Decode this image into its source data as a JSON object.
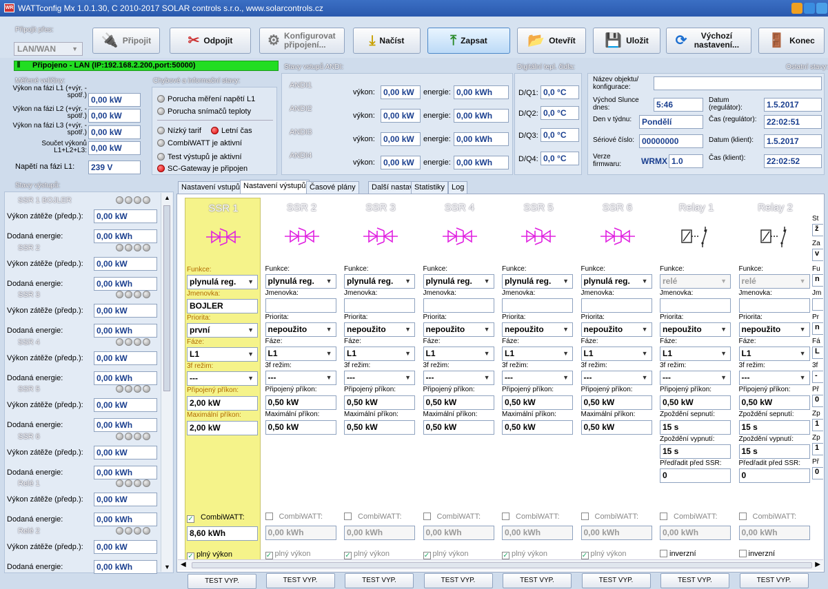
{
  "window": {
    "title": "WATTconfig Mx 1.0.1.30, C 2010-2017 SOLAR controls s.r.o., www.solarcontrols.cz",
    "app_icon": "WR"
  },
  "connect": {
    "group_title": "Připojit přes:",
    "via": "LAN/WAN"
  },
  "toolbar": {
    "connect": "Připojit",
    "disconnect": "Odpojit",
    "config_connection": "Konfigurovat připojení...",
    "load": "Načíst",
    "write": "Zapsat",
    "open": "Otevřít",
    "save": "Uložit",
    "defaults": "Výchozí nastavení...",
    "exit": "Konec"
  },
  "status": {
    "text": "Připojeno - LAN (IP:192.168.2.200,port:50000)",
    "color": "#22dd22"
  },
  "measured": {
    "title": "Měřené veličiny:",
    "rows": [
      {
        "label": "Výkon na fázi L1 (+výr. -spotř.)",
        "value": "0,00 kW"
      },
      {
        "label": "Výkon na fázi L2 (+výr. -spotř.)",
        "value": "0,00 kW"
      },
      {
        "label": "Výkon na fázi L3 (+výr. -spotř.)",
        "value": "0,00 kW"
      },
      {
        "label": "Součet výkonů L1+L2+L3:",
        "value": "0,00 kW"
      }
    ],
    "voltage_label": "Napětí na fázi L1:",
    "voltage_value": "239 V"
  },
  "errors": {
    "title": "Chybové a informační stavy:",
    "items": [
      "Porucha měření napětí L1",
      "Porucha snímačů teploty"
    ],
    "tariff": "Nízký tarif",
    "summer": "Letní čas",
    "combi": "CombiWATT je aktivní",
    "test": "Test výstupů je aktivní",
    "gateway": "SC-Gateway je připojen"
  },
  "andi": {
    "title": "Stavy vstupů ANDI:",
    "power_label": "výkon:",
    "energy_label": "energie:",
    "rows": [
      {
        "name": "ANDI1",
        "power": "0,00 kW",
        "energy": "0,00 kWh"
      },
      {
        "name": "ANDI2",
        "power": "0,00 kW",
        "energy": "0,00 kWh"
      },
      {
        "name": "ANDI3",
        "power": "0,00 kW",
        "energy": "0,00 kWh"
      },
      {
        "name": "ANDI4",
        "power": "0,00 kW",
        "energy": "0,00 kWh"
      }
    ]
  },
  "digital": {
    "title": "Digitální tepl. čidla:",
    "rows": [
      {
        "name": "D/Q1:",
        "value": "0,0 °C"
      },
      {
        "name": "D/Q2:",
        "value": "0,0 °C"
      },
      {
        "name": "D/Q3:",
        "value": "0,0 °C"
      },
      {
        "name": "D/Q4:",
        "value": "0,0 °C"
      }
    ]
  },
  "other": {
    "title": "Ostatní stavy:",
    "object_label": "Název objektu/ konfigurace:",
    "object_value": "",
    "sunrise_label": "Východ Slunce dnes:",
    "sunrise_value": "5:46",
    "date_reg_label": "Datum (regulátor):",
    "date_reg_value": "1.5.2017",
    "weekday_label": "Den v týdnu:",
    "weekday_value": "Pondělí",
    "time_reg_label": "Čas (regulátor):",
    "time_reg_value": "22:02:51",
    "serial_label": "Sériové číslo:",
    "serial_value": "00000000",
    "date_client_label": "Datum (klient):",
    "date_client_value": "1.5.2017",
    "fw_label": "Verze firmwaru:",
    "fw_name": "WRMX",
    "fw_version": "1.0",
    "time_client_label": "Čas (klient):",
    "time_client_value": "22:02:52"
  },
  "outputs": {
    "title": "Stavy výstupů:",
    "load_label": "Výkon zátěže (předp.):",
    "energy_label": "Dodaná energie:",
    "items": [
      {
        "name": "SSR 1 BOJLER",
        "load": "0,00 kW",
        "energy": "0,00 kWh"
      },
      {
        "name": "SSR 2",
        "load": "0,00 kW",
        "energy": "0,00 kWh"
      },
      {
        "name": "SSR 3",
        "load": "0,00 kW",
        "energy": "0,00 kWh"
      },
      {
        "name": "SSR 4",
        "load": "0,00 kW",
        "energy": "0,00 kWh"
      },
      {
        "name": "SSR 5",
        "load": "0,00 kW",
        "energy": "0,00 kWh"
      },
      {
        "name": "SSR 6",
        "load": "0,00 kW",
        "energy": "0,00 kWh"
      },
      {
        "name": "Relé 1",
        "load": "0,00 kW",
        "energy": "0,00 kWh"
      },
      {
        "name": "Relé 2",
        "load": "0,00 kW",
        "energy": "0,00 kWh"
      }
    ]
  },
  "tabs": [
    "Nastavení vstupů",
    "Nastavení výstupů",
    "Časové plány",
    "Další nastavení",
    "Statistiky",
    "Log"
  ],
  "active_tab": 1,
  "fields": {
    "function": "Funkce:",
    "name": "Jmenovka:",
    "priority": "Priorita:",
    "phase": "Fáze:",
    "mode3f": "3f režim:",
    "connected": "Připojený příkon:",
    "max": "Maximální příkon:",
    "on_delay": "Zpoždění sepnutí:",
    "off_delay": "Zpoždění vypnutí:",
    "preset": "Předřadit před SSR:",
    "combi": "CombiWATT:",
    "full_power": "plný výkon",
    "inverse": "inverzní",
    "test": "TEST VYP."
  },
  "columns": [
    {
      "title": "SSR 1",
      "type": "ssr",
      "function": "plynulá reg.",
      "name": "BOJLER",
      "priority": "první",
      "phase": "L1",
      "mode3f": "---",
      "connected": "2,00 kW",
      "max": "2,00 kW",
      "combi_checked": true,
      "combi_value": "8,60 kWh",
      "full_checked": true
    },
    {
      "title": "SSR 2",
      "type": "ssr",
      "function": "plynulá reg.",
      "name": "",
      "priority": "nepoužito",
      "phase": "L1",
      "mode3f": "---",
      "connected": "0,50 kW",
      "max": "0,50 kW",
      "combi_checked": false,
      "combi_value": "0,00 kWh",
      "full_checked": true
    },
    {
      "title": "SSR 3",
      "type": "ssr",
      "function": "plynulá reg.",
      "name": "",
      "priority": "nepoužito",
      "phase": "L1",
      "mode3f": "---",
      "connected": "0,50 kW",
      "max": "0,50 kW",
      "combi_checked": false,
      "combi_value": "0,00 kWh",
      "full_checked": true
    },
    {
      "title": "SSR 4",
      "type": "ssr",
      "function": "plynulá reg.",
      "name": "",
      "priority": "nepoužito",
      "phase": "L1",
      "mode3f": "---",
      "connected": "0,50 kW",
      "max": "0,50 kW",
      "combi_checked": false,
      "combi_value": "0,00 kWh",
      "full_checked": true
    },
    {
      "title": "SSR 5",
      "type": "ssr",
      "function": "plynulá reg.",
      "name": "",
      "priority": "nepoužito",
      "phase": "L1",
      "mode3f": "---",
      "connected": "0,50 kW",
      "max": "0,50 kW",
      "combi_checked": false,
      "combi_value": "0,00 kWh",
      "full_checked": true
    },
    {
      "title": "SSR 6",
      "type": "ssr",
      "function": "plynulá reg.",
      "name": "",
      "priority": "nepoužito",
      "phase": "L1",
      "mode3f": "---",
      "connected": "0,50 kW",
      "max": "0,50 kW",
      "combi_checked": false,
      "combi_value": "0,00 kWh",
      "full_checked": true
    },
    {
      "title": "Relay 1",
      "type": "relay",
      "function": "relé",
      "name": "",
      "priority": "nepoužito",
      "phase": "L1",
      "mode3f": "---",
      "connected": "0,50 kW",
      "on_delay": "15 s",
      "off_delay": "15 s",
      "preset": "0",
      "combi_checked": false,
      "combi_value": "0,00 kWh",
      "inverse_checked": false
    },
    {
      "title": "Relay 2",
      "type": "relay",
      "function": "relé",
      "name": "",
      "priority": "nepoužito",
      "phase": "L1",
      "mode3f": "---",
      "connected": "0,50 kW",
      "on_delay": "15 s",
      "off_delay": "15 s",
      "preset": "0",
      "combi_checked": false,
      "combi_value": "0,00 kWh",
      "inverse_checked": false
    }
  ],
  "partial_col": {
    "labels": [
      "St",
      "Za",
      "Fu",
      "Jm",
      "Pr",
      "Fá",
      "3f",
      "Př",
      "Zp",
      "Zp",
      "Př"
    ],
    "values": [
      "ž",
      "v",
      "n",
      "",
      "n",
      "L",
      "-",
      "0",
      "1",
      "1",
      "0"
    ]
  }
}
